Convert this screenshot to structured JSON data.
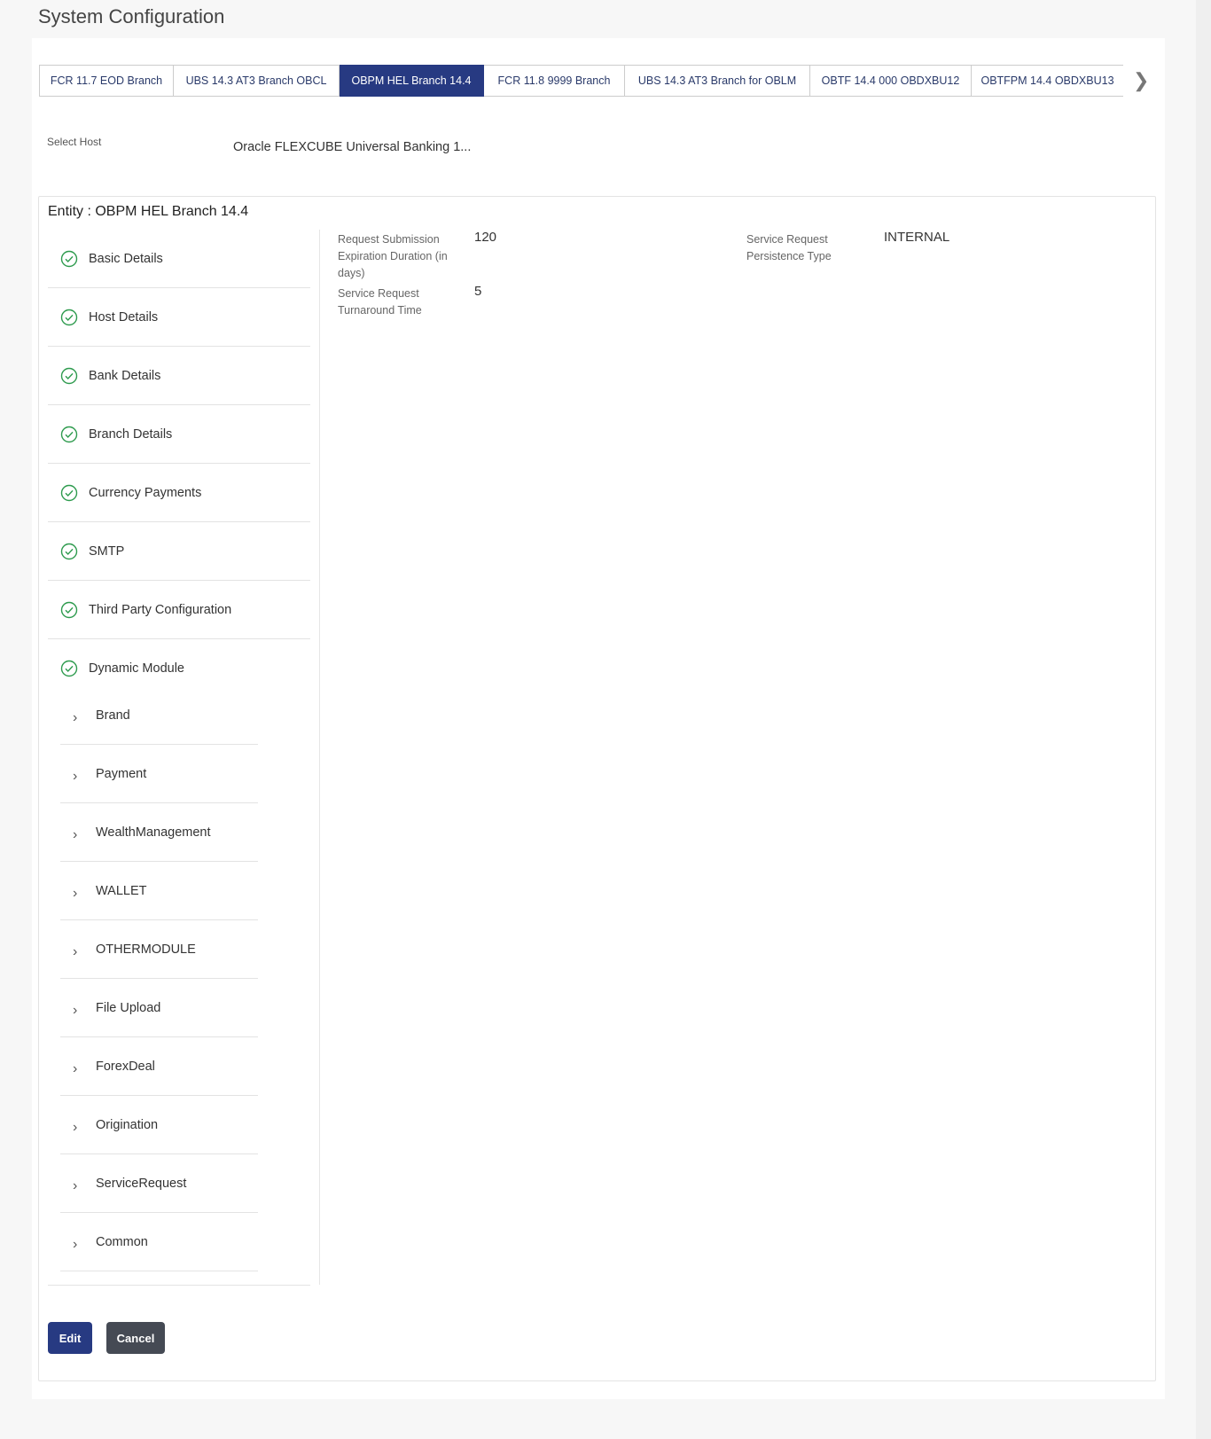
{
  "page_title": "System Configuration",
  "tabs": [
    {
      "label": "FCR 11.7 EOD Branch",
      "active": false
    },
    {
      "label": "UBS 14.3 AT3 Branch OBCL",
      "active": false
    },
    {
      "label": "OBPM HEL Branch 14.4",
      "active": true
    },
    {
      "label": "FCR 11.8 9999 Branch",
      "active": false
    },
    {
      "label": "UBS 14.3 AT3 Branch for OBLM",
      "active": false
    },
    {
      "label": "OBTF 14.4 000 OBDXBU12",
      "active": false
    },
    {
      "label": "OBTFPM 14.4 OBDXBU13",
      "active": false
    }
  ],
  "host": {
    "label": "Select Host",
    "value": "Oracle FLEXCUBE Universal Banking 1..."
  },
  "entity_title": "Entity : OBPM HEL Branch 14.4",
  "nav": {
    "items": [
      "Basic Details",
      "Host Details",
      "Bank Details",
      "Branch Details",
      "Currency Payments",
      "SMTP",
      "Third Party Configuration",
      "Dynamic Module"
    ],
    "sub_items": [
      "Brand",
      "Payment",
      "WealthManagement",
      "WALLET",
      "OTHERMODULE",
      "File Upload",
      "ForexDeal",
      "Origination",
      "ServiceRequest",
      "Common"
    ]
  },
  "fields": [
    {
      "label": "Request Submission Expiration Duration (in days)",
      "value": "120"
    },
    {
      "label": "Service Request Turnaround Time",
      "value": "5"
    },
    {
      "label": "Service Request Persistence Type",
      "value": "INTERNAL"
    }
  ],
  "buttons": {
    "edit": "Edit",
    "cancel": "Cancel"
  },
  "colors": {
    "primary": "#273a82",
    "secondary": "#454a54",
    "check": "#2e9b4e"
  }
}
